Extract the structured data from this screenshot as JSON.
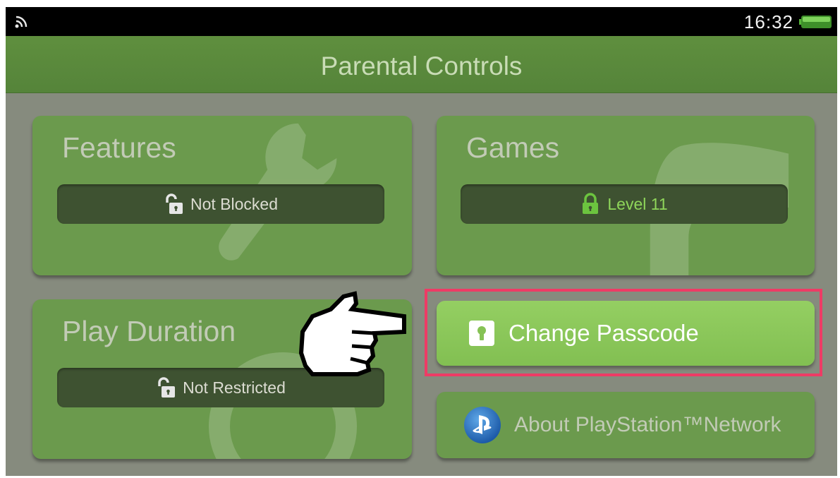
{
  "status_bar": {
    "time": "16:32",
    "wifi_icon": "wifi-icon",
    "battery_icon": "battery-icon"
  },
  "header": {
    "title": "Parental Controls"
  },
  "tiles": {
    "features": {
      "heading": "Features",
      "status": "Not Blocked",
      "lock_icon": "unlocked-icon"
    },
    "games": {
      "heading": "Games",
      "status": "Level 11",
      "lock_icon": "locked-icon"
    },
    "play_duration": {
      "heading": "Play Duration",
      "status": "Not Restricted",
      "lock_icon": "unlocked-icon"
    }
  },
  "buttons": {
    "change_passcode": {
      "label": "Change Passcode",
      "icon": "keyhole-icon"
    },
    "about_psn": {
      "label": "About PlayStation™Network",
      "icon": "playstation-icon"
    }
  },
  "colors": {
    "title_bar": "#5f8f3e",
    "tile": "#6b9a4d",
    "pill": "#3e5231",
    "active_button": "#8cc85a",
    "highlight": "#ee3b65",
    "level_text": "#8fd65a"
  }
}
